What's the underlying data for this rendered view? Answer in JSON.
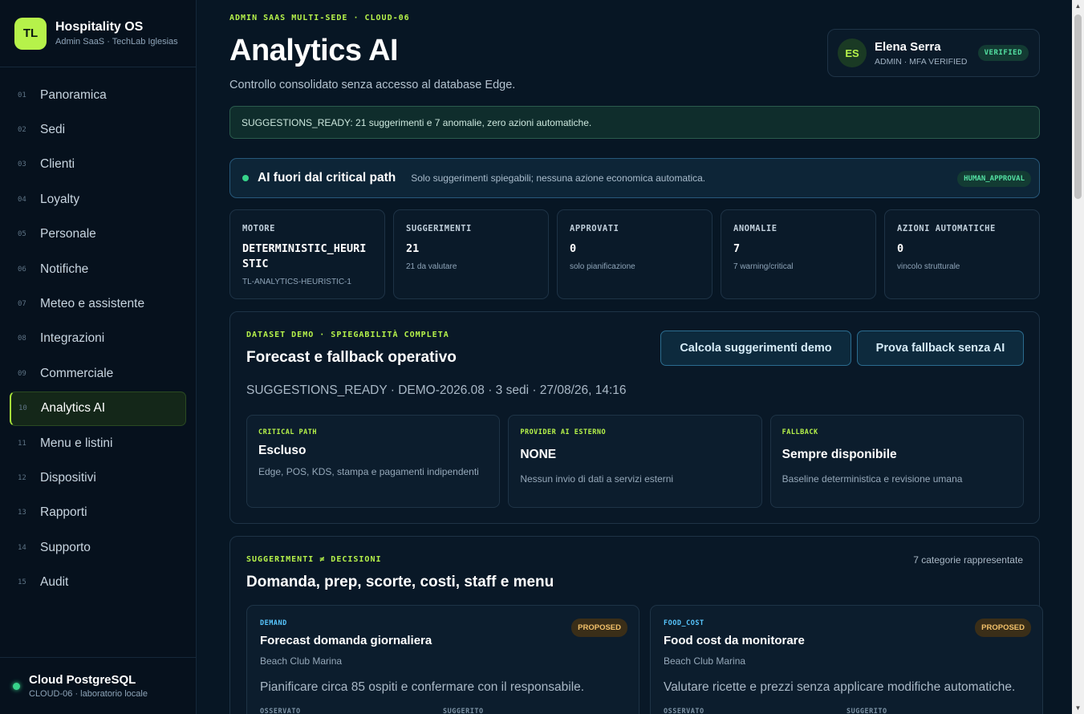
{
  "brand": {
    "logo": "TL",
    "title": "Hospitality OS",
    "subtitle": "Admin SaaS · TechLab Iglesias"
  },
  "nav": [
    {
      "num": "01",
      "label": "Panoramica"
    },
    {
      "num": "02",
      "label": "Sedi"
    },
    {
      "num": "03",
      "label": "Clienti"
    },
    {
      "num": "04",
      "label": "Loyalty"
    },
    {
      "num": "05",
      "label": "Personale"
    },
    {
      "num": "06",
      "label": "Notifiche"
    },
    {
      "num": "07",
      "label": "Meteo e assistente"
    },
    {
      "num": "08",
      "label": "Integrazioni"
    },
    {
      "num": "09",
      "label": "Commerciale"
    },
    {
      "num": "10",
      "label": "Analytics AI",
      "active": true
    },
    {
      "num": "11",
      "label": "Menu e listini"
    },
    {
      "num": "12",
      "label": "Dispositivi"
    },
    {
      "num": "13",
      "label": "Rapporti"
    },
    {
      "num": "14",
      "label": "Supporto"
    },
    {
      "num": "15",
      "label": "Audit"
    }
  ],
  "footer": {
    "title": "Cloud PostgreSQL",
    "subtitle": "CLOUD-06 · laboratorio locale"
  },
  "header": {
    "eyebrow": "ADMIN SAAS MULTI-SEDE · CLOUD-06",
    "title": "Analytics AI",
    "subtitle": "Controllo consolidato senza accesso al database Edge."
  },
  "user": {
    "initials": "ES",
    "name": "Elena Serra",
    "role": "ADMIN · MFA VERIFIED",
    "badge": "VERIFIED"
  },
  "alert": "SUGGESTIONS_READY: 21 suggerimenti e 7 anomalie, zero azioni automatiche.",
  "ai_banner": {
    "title": "AI fuori dal critical path",
    "subtitle": "Solo suggerimenti spiegabili; nessuna azione economica automatica.",
    "badge": "HUMAN_APPROVAL"
  },
  "kpis": [
    {
      "label": "MOTORE",
      "value": "DETERMINISTIC_HEURISTIC",
      "hint": "TL-ANALYTICS-HEURISTIC-1"
    },
    {
      "label": "SUGGERIMENTI",
      "value": "21",
      "hint": "21 da valutare"
    },
    {
      "label": "APPROVATI",
      "value": "0",
      "hint": "solo pianificazione"
    },
    {
      "label": "ANOMALIE",
      "value": "7",
      "hint": "7 warning/critical"
    },
    {
      "label": "AZIONI AUTOMATICHE",
      "value": "0",
      "hint": "vincolo strutturale"
    }
  ],
  "dataset": {
    "eyebrow": "DATASET DEMO · SPIEGABILITÀ COMPLETA",
    "title": "Forecast e fallback operativo",
    "btn_calc": "Calcola suggerimenti demo",
    "btn_fallback": "Prova fallback senza AI",
    "status": "SUGGESTIONS_READY · DEMO-2026.08 · 3 sedi · 27/08/26, 14:16",
    "cards": [
      {
        "label": "CRITICAL PATH",
        "value": "Escluso",
        "desc": "Edge, POS, KDS, stampa e pagamenti indipendenti"
      },
      {
        "label": "PROVIDER AI ESTERNO",
        "value": "NONE",
        "desc": "Nessun invio di dati a servizi esterni"
      },
      {
        "label": "FALLBACK",
        "value": "Sempre disponibile",
        "desc": "Baseline deterministica e revisione umana"
      }
    ]
  },
  "suggestions": {
    "eyebrow": "SUGGERIMENTI ≠ DECISIONI",
    "title": "Domanda, prep, scorte, costi, staff e menu",
    "count": "7 categorie rappresentate",
    "items": [
      {
        "category": "DEMAND",
        "status": "PROPOSED",
        "title": "Forecast domanda giornaliera",
        "site": "Beach Club Marina",
        "desc": "Pianificare circa 85 ospiti e confermare con il responsabile.",
        "col1": "OSSERVATO",
        "col2": "SUGGERITO"
      },
      {
        "category": "FOOD_COST",
        "status": "PROPOSED",
        "title": "Food cost da monitorare",
        "site": "Beach Club Marina",
        "desc": "Valutare ricette e prezzi senza applicare modifiche automatiche.",
        "col1": "OSSERVATO",
        "col2": "SUGGERITO"
      }
    ]
  }
}
